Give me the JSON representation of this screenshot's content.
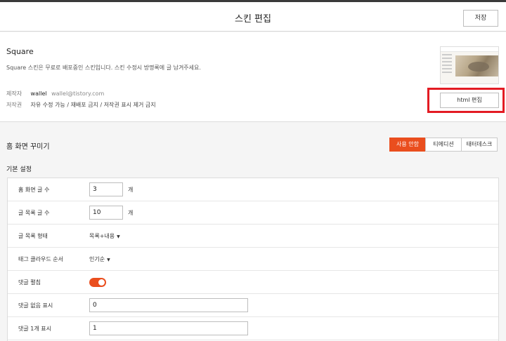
{
  "header": {
    "title": "스킨 편집",
    "save_label": "저장"
  },
  "skin": {
    "name": "Square",
    "description": "Square 스킨은 무료로 배포중인 스킨입니다. 스킨 수정시 방명록에 글 남겨주세요.",
    "author_key": "제작자",
    "author": "wallel",
    "author_email": "wallel@tistory.com",
    "license_key": "저작권",
    "license": "자유 수정 가능 / 재배포 금지 / 저작권 표시 제거 금지",
    "html_edit_label": "html 편집"
  },
  "home_section": {
    "title": "홈 화면 꾸미기",
    "tabs": [
      {
        "label": "사용 안함",
        "active": true
      },
      {
        "label": "티에디션",
        "active": false
      },
      {
        "label": "태터데스크",
        "active": false
      }
    ]
  },
  "basic_settings": {
    "title": "기본 설정",
    "rows": [
      {
        "label": "홈 화면 글 수",
        "value": "3",
        "unit": "개"
      },
      {
        "label": "글 목록 글 수",
        "value": "10",
        "unit": "개"
      },
      {
        "label": "글 목록 형태",
        "value": "목록+내용"
      },
      {
        "label": "태그 클라우드 순서",
        "value": "인기순"
      },
      {
        "label": "댓글 펼침",
        "toggle_on": true
      },
      {
        "label": "댓글 없음 표시",
        "value": "0"
      },
      {
        "label": "댓글 1개 표시",
        "value": "1"
      }
    ]
  },
  "colors": {
    "accent": "#ea4e1e",
    "highlight": "#e31b23"
  }
}
